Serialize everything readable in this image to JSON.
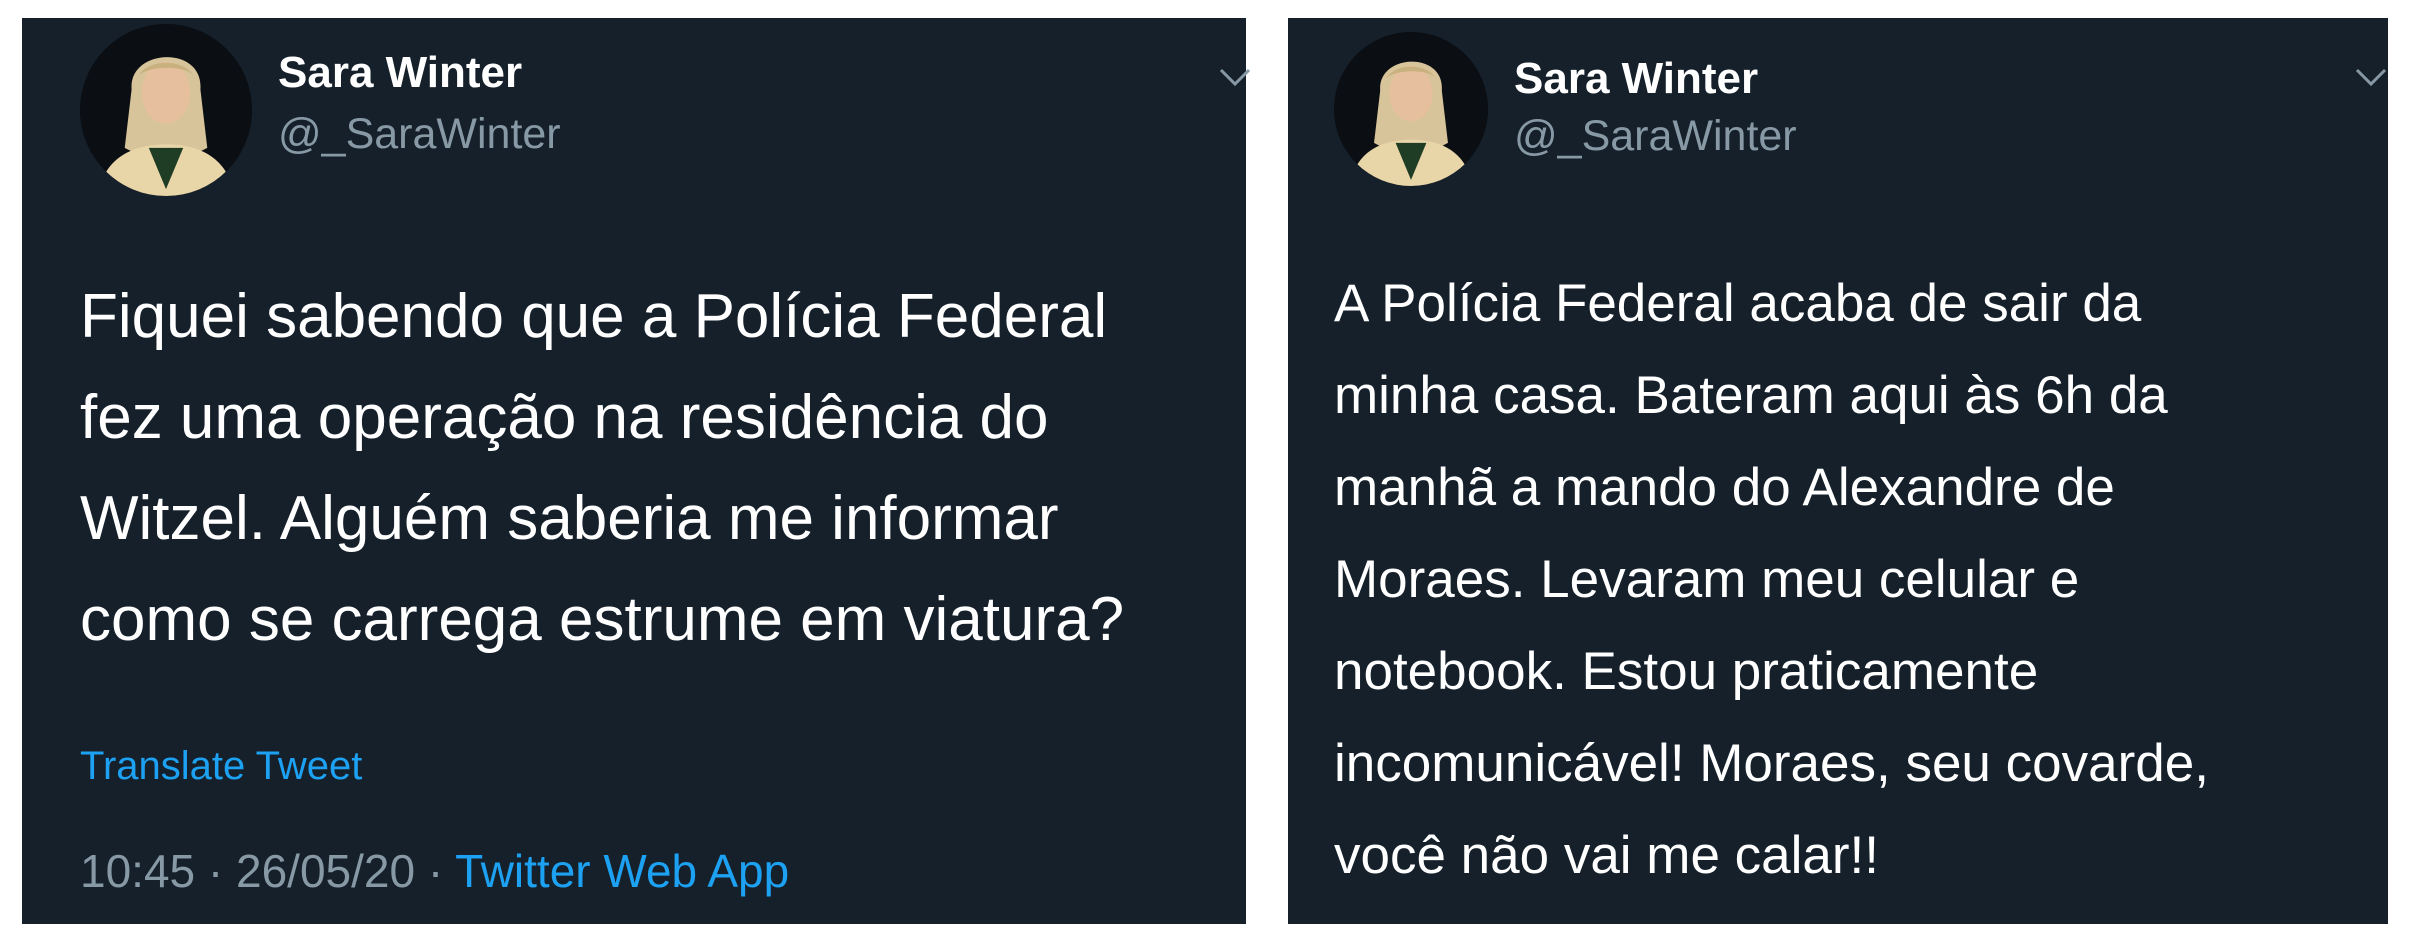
{
  "tweets": [
    {
      "author": {
        "display_name": "Sara Winter",
        "handle": "@_SaraWinter"
      },
      "text_lines": [
        "Fiquei sabendo que a Polícia Federal",
        "fez uma operação na residência do",
        "Witzel. Alguém saberia me informar",
        "como se carrega estrume em viatura?"
      ],
      "translate_label": "Translate Tweet",
      "time": "10:45",
      "date": "26/05/20",
      "separator": "·",
      "source": "Twitter Web App",
      "icons": [
        "avatar",
        "chevron-down-icon"
      ]
    },
    {
      "author": {
        "display_name": "Sara Winter",
        "handle": "@_SaraWinter"
      },
      "text_lines": [
        "A Polícia Federal acaba de sair da",
        "minha casa. Bateram aqui às 6h da",
        "manhã a mando do Alexandre de",
        "Moraes. Levaram meu celular e",
        "notebook. Estou praticamente",
        "incomunicável! Moraes, seu covarde,",
        "você não vai me calar!!"
      ],
      "icons": [
        "avatar",
        "chevron-down-icon"
      ]
    }
  ],
  "colors": {
    "tweet_background": "#15202b",
    "primary_text": "#ffffff",
    "secondary_text": "#8899a6",
    "link": "#1da1f2",
    "page_background": "#ffffff"
  }
}
